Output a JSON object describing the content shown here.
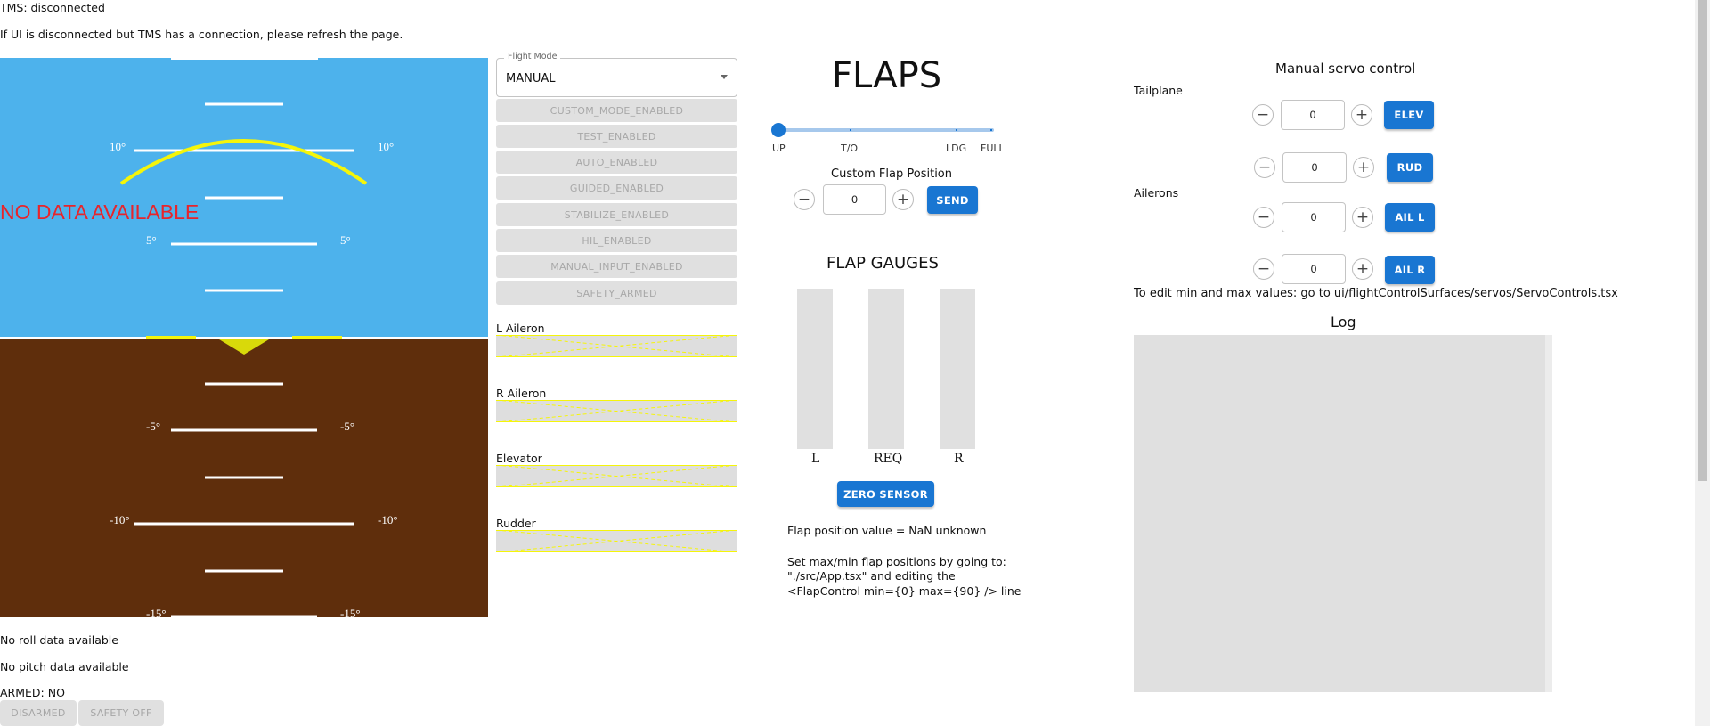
{
  "status": {
    "tms": "TMS: disconnected",
    "refresh_hint": "If UI is disconnected but TMS has a connection, please refresh the page.",
    "no_roll": "No roll data available",
    "no_pitch": "No pitch data available",
    "armed": "ARMED: NO"
  },
  "horizon": {
    "no_data": "NO DATA AVAILABLE",
    "labels": [
      "10°",
      "5°",
      "-5°",
      "-10°",
      "-15°"
    ],
    "colors": {
      "sky": "#4db2ec",
      "ground": "#5f2e0c",
      "marker": "#f5f50a"
    }
  },
  "arming": {
    "disarmed": "DISARMED",
    "safety": "SAFETY OFF"
  },
  "flight_mode": {
    "label": "Flight Mode",
    "value": "MANUAL",
    "modes": [
      "CUSTOM_MODE_ENABLED",
      "TEST_ENABLED",
      "AUTO_ENABLED",
      "GUIDED_ENABLED",
      "STABILIZE_ENABLED",
      "HIL_ENABLED",
      "MANUAL_INPUT_ENABLED",
      "SAFETY_ARMED"
    ]
  },
  "surfaces": [
    "L Aileron",
    "R Aileron",
    "Elevator",
    "Rudder"
  ],
  "flaps": {
    "title": "FLAPS",
    "slider_labels": [
      "UP",
      "T/O",
      "LDG",
      "FULL"
    ],
    "custom_label": "Custom Flap Position",
    "custom_value": "0",
    "send": "SEND",
    "gauges_title": "FLAP GAUGES",
    "gauge_labels": [
      "L",
      "REQ",
      "R"
    ],
    "zero_sensor": "ZERO SENSOR",
    "position_value": "Flap position value = NaN unknown",
    "hint_line1": "Set max/min flap positions by going to:",
    "hint_line2": "\"./src/App.tsx\" and editing the",
    "hint_line3": "<FlapControl min={0} max={90} /> line"
  },
  "servo": {
    "title": "Manual servo control",
    "tailplane": "Tailplane",
    "ailerons": "Ailerons",
    "rows": [
      {
        "value": "0",
        "button": "ELEV"
      },
      {
        "value": "0",
        "button": "RUD"
      },
      {
        "value": "0",
        "button": "AIL L"
      },
      {
        "value": "0",
        "button": "AIL R"
      }
    ],
    "hint": "To edit min and max values: go to ui/flightControlSurfaces/servos/ServoControls.tsx",
    "log_title": "Log"
  },
  "accent": "#1976d2"
}
